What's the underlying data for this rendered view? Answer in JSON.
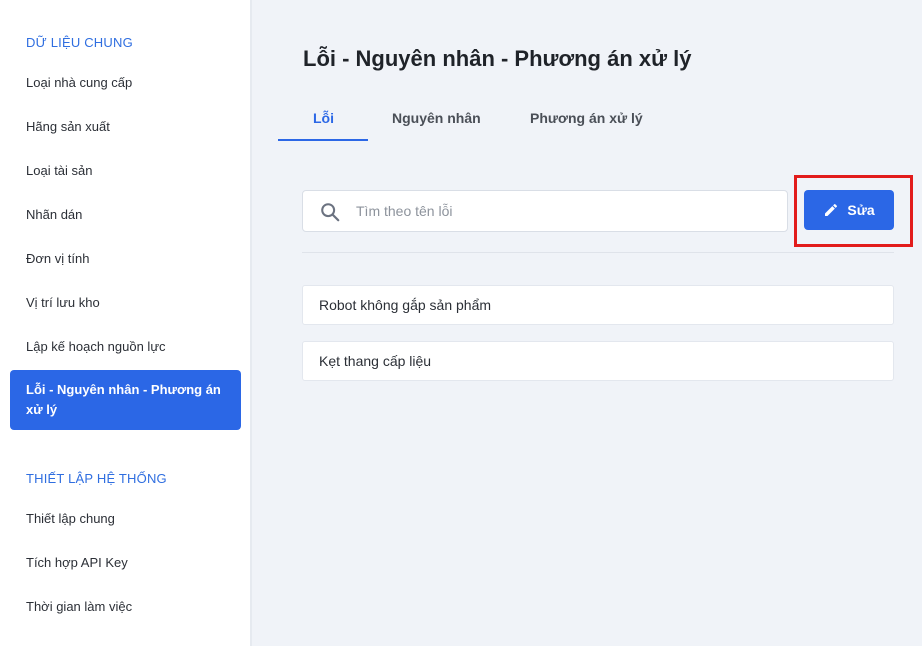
{
  "sidebar": {
    "section_data_title": "DỮ LIỆU CHUNG",
    "items": [
      {
        "label": "Loại nhà cung cấp"
      },
      {
        "label": "Hãng sản xuất"
      },
      {
        "label": "Loại tài sản"
      },
      {
        "label": "Nhãn dán"
      },
      {
        "label": "Đơn vị tính"
      },
      {
        "label": "Vị trí lưu kho"
      },
      {
        "label": "Lập kế hoạch nguồn lực"
      },
      {
        "label": "Lỗi - Nguyên nhân - Phương án xử lý"
      }
    ],
    "section_system_title": "THIẾT LẬP HỆ THỐNG",
    "system_items": [
      {
        "label": "Thiết lập chung"
      },
      {
        "label": "Tích hợp API Key"
      },
      {
        "label": "Thời gian làm việc"
      }
    ]
  },
  "main": {
    "title": "Lỗi - Nguyên nhân - Phương án xử lý",
    "tabs": [
      {
        "label": "Lỗi"
      },
      {
        "label": "Nguyên nhân"
      },
      {
        "label": "Phương án xử lý"
      }
    ],
    "search": {
      "placeholder": "Tìm theo tên lỗi"
    },
    "edit_label": "Sửa",
    "errors": [
      {
        "label": "Robot không gắp sản phẩm"
      },
      {
        "label": "Kẹt thang cấp liệu"
      }
    ]
  },
  "colors": {
    "accent": "#2b67e6",
    "highlight": "#e21b1b"
  },
  "icons": {
    "search": "search-icon",
    "edit": "pencil-icon"
  }
}
